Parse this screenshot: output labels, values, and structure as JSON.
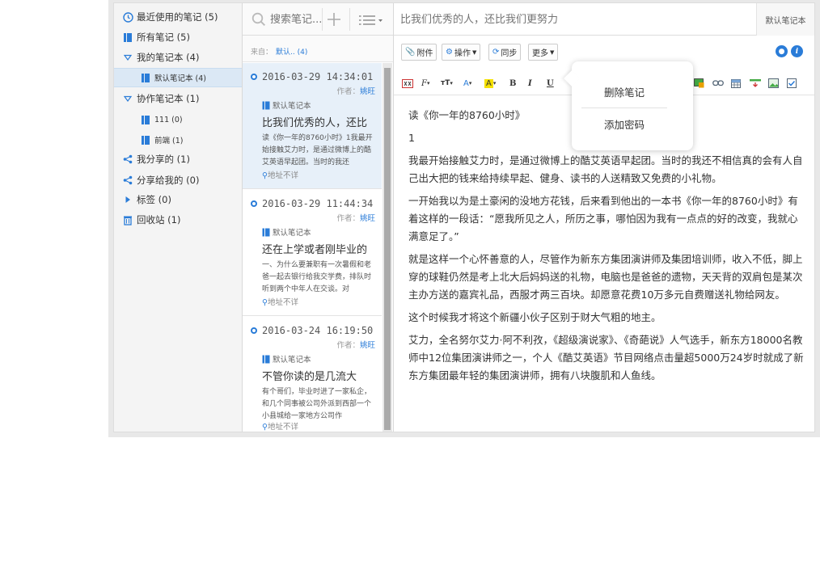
{
  "sidebar": {
    "items": [
      {
        "label": "最近使用的笔记 (5)",
        "icon": "clock-icon"
      },
      {
        "label": "所有笔记 (5)",
        "icon": "book-icon"
      },
      {
        "label": "我的笔记本 (4)",
        "icon": "caret-down-icon"
      },
      {
        "label": "默认笔记本 (4)",
        "icon": "notebook-icon"
      },
      {
        "label": "协作笔记本 (1)",
        "icon": "caret-down-icon"
      },
      {
        "label": "111 (0)",
        "icon": "notebook-icon"
      },
      {
        "label": "前端 (1)",
        "icon": "notebook-icon"
      },
      {
        "label": "我分享的 (1)",
        "icon": "share-icon"
      },
      {
        "label": "分享给我的 (0)",
        "icon": "share-icon"
      },
      {
        "label": "标签 (0)",
        "icon": "caret-right-icon"
      },
      {
        "label": "回收站 (1)",
        "icon": "trash-icon"
      }
    ]
  },
  "search": {
    "placeholder": "搜索笔记..."
  },
  "from_bar": {
    "label": "来自：",
    "value": "默认.. (4)"
  },
  "notes": [
    {
      "date": "2016-03-29 14:34:01",
      "author_label": "作者：",
      "author": "姚旺",
      "notebook": "默认笔记本",
      "title": "比我们优秀的人，还比",
      "snippet": "读《你一年的8760小时》1我最开始接触艾力时，是通过微博上的酷艾英语早起团。当时的我还",
      "location": "地址不详"
    },
    {
      "date": "2016-03-29 11:44:34",
      "author_label": "作者：",
      "author": "姚旺",
      "notebook": "默认笔记本",
      "title": "还在上学或者刚毕业的",
      "snippet": "一、为什么要兼职有一次暑假和老爸一起去银行给我交学费，排队时听到两个中年人在交谈。对",
      "location": "地址不详"
    },
    {
      "date": "2016-03-24 16:19:50",
      "author_label": "作者：",
      "author": "姚旺",
      "notebook": "默认笔记本",
      "title": "不管你读的是几流大",
      "snippet": "有个哥们，毕业时进了一家私企，和几个同事被公司外派到西部一个小县城给一家地方公司作",
      "location": "地址不详"
    }
  ],
  "editor": {
    "title_placeholder": "比我们优秀的人，还比我们更努力",
    "notebook": "默认笔记本",
    "toolbar": {
      "attach": "附件",
      "operate": "操作",
      "sync": "同步",
      "more": "更多"
    },
    "content": [
      "读《你一年的8760小时》",
      "1",
      "我最开始接触艾力时，是通过微博上的酷艾英语早起团。当时的我还不相信真的会有人自己出大把的钱来给持续早起、健身、读书的人送精致又免费的小礼物。",
      "一开始我以为是土豪闲的没地方花钱，后来看到他出的一本书《你一年的8760小时》有着这样的一段话：“愿我所见之人，所历之事，哪怕因为我有一点点的好的改变，我就心满意足了。”",
      "就是这样一个心怀善意的人，尽管作为新东方集团演讲师及集团培训师，收入不低，脚上穿的球鞋仍然是考上北大后妈妈送的礼物，电脑也是爸爸的遗物，天天背的双肩包是某次主办方送的嘉宾礼品，西服才两三百块。却愿意花费10万多元自费赠送礼物给网友。",
      "这个时候我才将这个新疆小伙子区别于财大气粗的地主。",
      "艾力，全名努尔艾力·阿不利孜，《超级演说家》、《奇葩说》人气选手，新东方18000名教师中12位集团演讲师之一，个人《酷艾英语》节目网络点击量超5000万24岁时就成了新东方集团最年轻的集团演讲师，拥有八块腹肌和人鱼线。"
    ]
  },
  "popup": {
    "items": [
      "删除笔记",
      "添加密码"
    ]
  }
}
